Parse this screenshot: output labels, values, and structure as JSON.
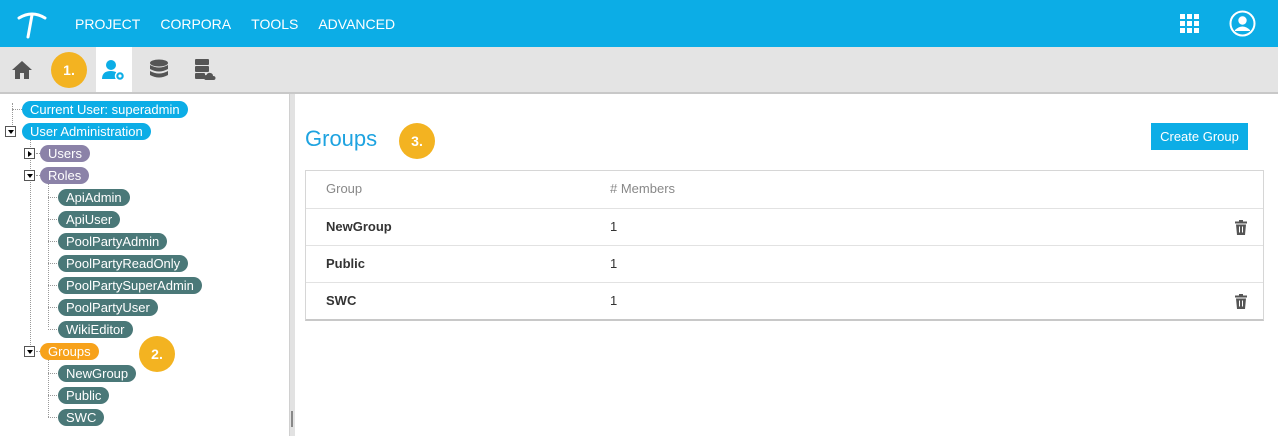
{
  "topnav": {
    "items": [
      "PROJECT",
      "CORPORA",
      "TOOLS",
      "ADVANCED"
    ]
  },
  "toolbar": {
    "badge1": "1."
  },
  "tree": {
    "current_user": "Current User: superadmin",
    "user_admin": "User Administration",
    "users": "Users",
    "roles": "Roles",
    "role_items": [
      "ApiAdmin",
      "ApiUser",
      "PoolPartyAdmin",
      "PoolPartyReadOnly",
      "PoolPartySuperAdmin",
      "PoolPartyUser",
      "WikiEditor"
    ],
    "groups": "Groups",
    "groups_badge": "2.",
    "group_items": [
      "NewGroup",
      "Public",
      "SWC"
    ]
  },
  "main": {
    "title": "Groups",
    "title_badge": "3.",
    "create_button": "Create Group",
    "columns": [
      "Group",
      "# Members"
    ],
    "rows": [
      {
        "group": "NewGroup",
        "members": "1",
        "deletable": true
      },
      {
        "group": "Public",
        "members": "1",
        "deletable": false
      },
      {
        "group": "SWC",
        "members": "1",
        "deletable": true
      }
    ]
  },
  "colors": {
    "accent": "#0cade6",
    "badge": "#f3b321",
    "role": "#4a7878",
    "groups_node": "#f7a21b"
  }
}
